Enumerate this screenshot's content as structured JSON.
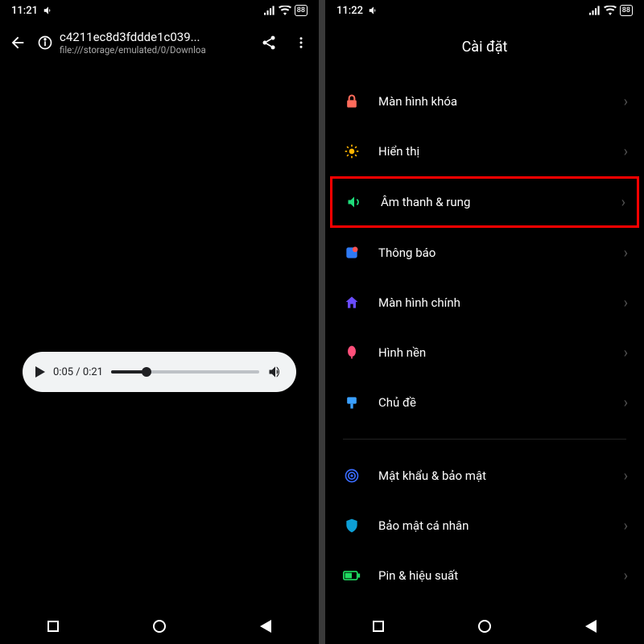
{
  "left": {
    "status": {
      "time": "11:21",
      "battery": "88"
    },
    "header": {
      "title": "c4211ec8d3fddde1c039...",
      "subtitle": "file:///storage/emulated/0/Downloa"
    },
    "player": {
      "elapsed": "0:05",
      "total": "0:21"
    }
  },
  "right": {
    "status": {
      "time": "11:22",
      "battery": "88"
    },
    "title": "Cài đặt",
    "items": [
      {
        "icon": "lock",
        "color": "#ff6b5b",
        "label": "Màn hình khóa",
        "hl": false
      },
      {
        "icon": "sun",
        "color": "#ffb400",
        "label": "Hiển thị",
        "hl": false
      },
      {
        "icon": "sound",
        "color": "#1edc7a",
        "label": "Âm thanh & rung",
        "hl": true
      },
      {
        "icon": "notif",
        "color": "#2f7af5",
        "label": "Thông báo",
        "hl": false
      },
      {
        "icon": "home",
        "color": "#6a4cff",
        "label": "Màn hình chính",
        "hl": false
      },
      {
        "icon": "wall",
        "color": "#ff4f7a",
        "label": "Hình nền",
        "hl": false
      },
      {
        "icon": "theme",
        "color": "#3aa0ff",
        "label": "Chủ đề",
        "hl": false
      }
    ],
    "items2": [
      {
        "icon": "finger",
        "color": "#3a6cff",
        "label": "Mật khẩu & bảo mật"
      },
      {
        "icon": "shield",
        "color": "#0d9fd6",
        "label": "Bảo mật cá nhân"
      },
      {
        "icon": "batt",
        "color": "#1fdc60",
        "label": "Pin & hiệu suất"
      }
    ]
  }
}
